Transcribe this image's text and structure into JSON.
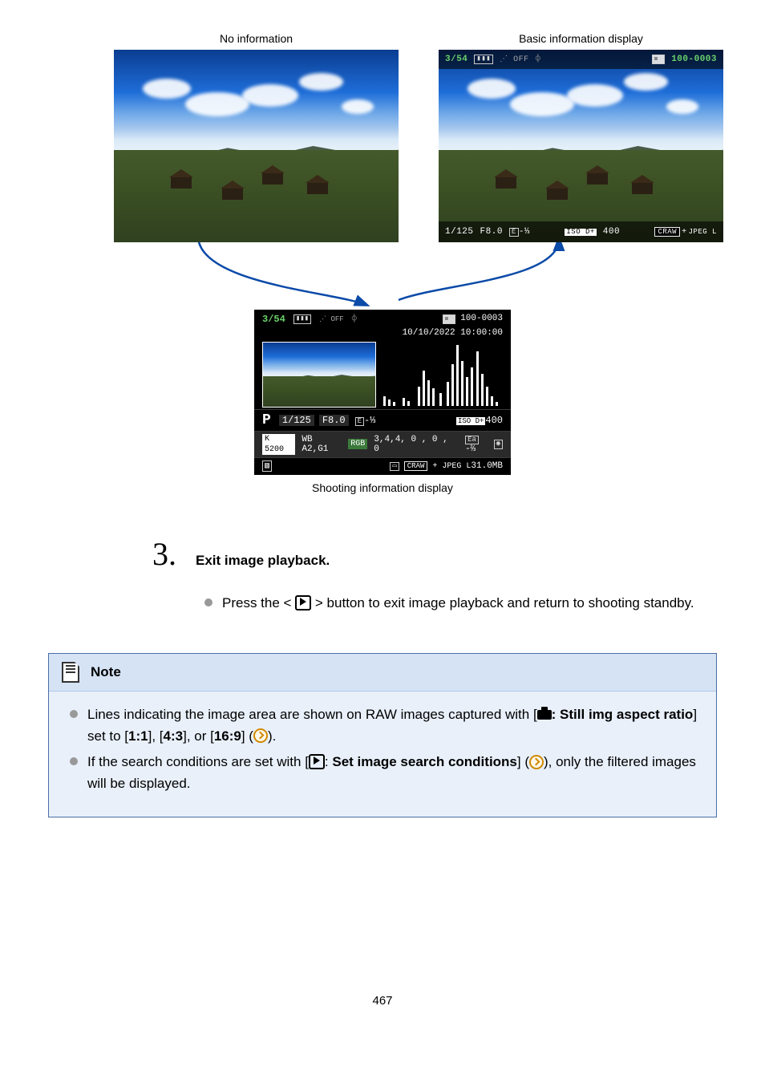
{
  "top": {
    "left_caption": "No information",
    "right_caption": "Basic information display"
  },
  "basic_overlay": {
    "counter": "3/54",
    "file": "100-0003",
    "shutter": "1/125",
    "aperture": "F8.0",
    "exp": "-⅓",
    "iso_badge": "ISO D+",
    "iso": "400",
    "raw": "CRAW",
    "jpeg": "JPEG L"
  },
  "shoot": {
    "counter": "3/54",
    "file": "100-0003",
    "datetime": "10/10/2022 10:00:00",
    "mode": "P",
    "shutter": "1/125",
    "aperture": "F8.0",
    "exp": "-⅓",
    "iso_badge": "ISO D+",
    "iso_val": "400",
    "k_line1": "K 5200",
    "wb": "WB A2,G1",
    "rgb": "RGB",
    "nums": "3,4,4, 0 , 0 , 0",
    "flash": "-⅔",
    "raw": "CRAW",
    "jpeg": "JPEG L",
    "size": "31.0MB",
    "caption": "Shooting information display"
  },
  "step": {
    "num": "3.",
    "title": "Exit image playback.",
    "body_before": "Press the < ",
    "body_after": " > button to exit image playback and return to shooting standby."
  },
  "note": {
    "title": "Note",
    "l1a": "Lines indicating the image area are shown on RAW images captured with [",
    "l1b": ": Still img aspect ratio",
    "l1c": "] set to [",
    "r11": "1:1",
    "l1d": "], [",
    "r43": "4:3",
    "l1e": "], or [",
    "r169": "16:9",
    "l1f": "] (",
    "l1g": ").",
    "l2a": "If the search conditions are set with [",
    "l2b": ": ",
    "l2c": "Set image search conditions",
    "l2d": "] (",
    "l2e": "), only the filtered images will be displayed."
  },
  "page_number": "467"
}
